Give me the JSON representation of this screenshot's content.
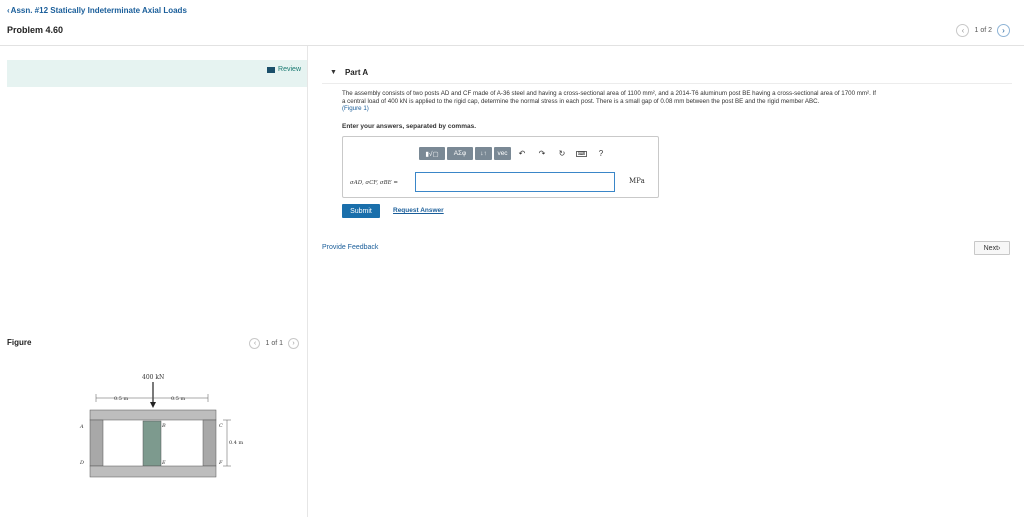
{
  "header": {
    "back_label": "Assn. #12 Statically Indeterminate Axial Loads",
    "problem_title": "Problem 4.60",
    "pager": {
      "text": "1 of 2"
    }
  },
  "left_panel": {
    "review_label": "Review",
    "figure_title": "Figure",
    "figure_pager": "1 of 1"
  },
  "figure": {
    "load_label": "400 kN",
    "dim_left": "0.5 m",
    "dim_right": "0.5 m",
    "dim_height": "0.4 m",
    "label_A": "A",
    "label_B": "B",
    "label_C": "C",
    "label_D": "D",
    "label_E": "E",
    "label_F": "F"
  },
  "part": {
    "title": "Part A",
    "text_line1": "The assembly consists of two posts AD and CF made of A-36 steel and having a cross-sectional area of 1100 mm², and a 2014-T6 aluminum post BE having a cross-sectional area of 1700 mm². If",
    "text_line2": "a central load of 400 kN is applied to the rigid cap, determine the normal stress in each post. There is a small gap of 0.08 mm between the post BE and the rigid member ABC.",
    "figure_link": "(Figure 1)",
    "instructions": "Enter your answers, separated by commas."
  },
  "answer": {
    "variable_label": "σAD, σCF, σBE =",
    "value": "",
    "unit": "MPa",
    "toolbar": {
      "templates": "▮√▢",
      "symbols": "AΣφ",
      "arrows": "↓↑",
      "vec": "vec",
      "undo": "↶",
      "redo": "↷",
      "reset": "↻",
      "keyboard": "⌨",
      "help": "?"
    }
  },
  "actions": {
    "submit_label": "Submit",
    "request_answer_label": "Request Answer",
    "feedback_label": "Provide Feedback",
    "next_label": "Next"
  },
  "colors": {
    "accent_blue": "#1a6fab",
    "review_band": "#e6f3f1",
    "steel_gray": "#a8a8a8",
    "aluminum_green": "#7d9a8e"
  }
}
